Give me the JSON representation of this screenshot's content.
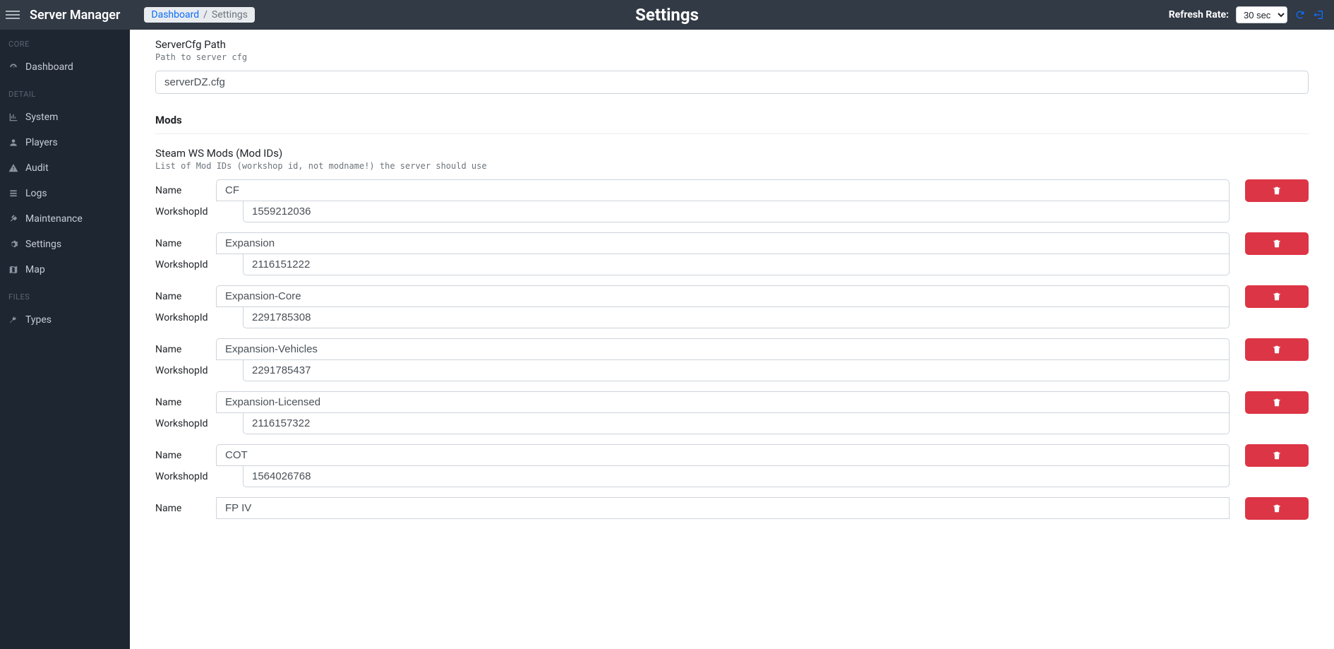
{
  "brand": "Server Manager",
  "page_title": "Settings",
  "breadcrumb": {
    "root": "Dashboard",
    "current": "Settings"
  },
  "refresh": {
    "label": "Refresh Rate:",
    "selected": "30 sec"
  },
  "sidebar": {
    "sections": [
      {
        "title": "CORE",
        "items": [
          {
            "icon": "dashboard-icon",
            "label": "Dashboard"
          }
        ]
      },
      {
        "title": "DETAIL",
        "items": [
          {
            "icon": "chart-icon",
            "label": "System"
          },
          {
            "icon": "user-icon",
            "label": "Players"
          },
          {
            "icon": "warning-icon",
            "label": "Audit"
          },
          {
            "icon": "list-icon",
            "label": "Logs"
          },
          {
            "icon": "tools-icon",
            "label": "Maintenance"
          },
          {
            "icon": "cogs-icon",
            "label": "Settings"
          },
          {
            "icon": "map-icon",
            "label": "Map"
          }
        ]
      },
      {
        "title": "FILES",
        "items": [
          {
            "icon": "wrench-icon",
            "label": "Types"
          }
        ]
      }
    ]
  },
  "form": {
    "servercfg": {
      "label": "ServerCfg Path",
      "desc": "Path to server cfg",
      "value": "serverDZ.cfg"
    },
    "mods_section_title": "Mods",
    "steam_mods": {
      "label": "Steam WS Mods (Mod IDs)",
      "desc": "List of Mod IDs (workshop id, not modname!) the server should use",
      "name_label": "Name",
      "id_label": "WorkshopId",
      "items": [
        {
          "name": "CF",
          "id": "1559212036"
        },
        {
          "name": "Expansion",
          "id": "2116151222"
        },
        {
          "name": "Expansion-Core",
          "id": "2291785308"
        },
        {
          "name": "Expansion-Vehicles",
          "id": "2291785437"
        },
        {
          "name": "Expansion-Licensed",
          "id": "2116157322"
        },
        {
          "name": "COT",
          "id": "1564026768"
        },
        {
          "name": "FP IV",
          "id": ""
        }
      ]
    }
  }
}
